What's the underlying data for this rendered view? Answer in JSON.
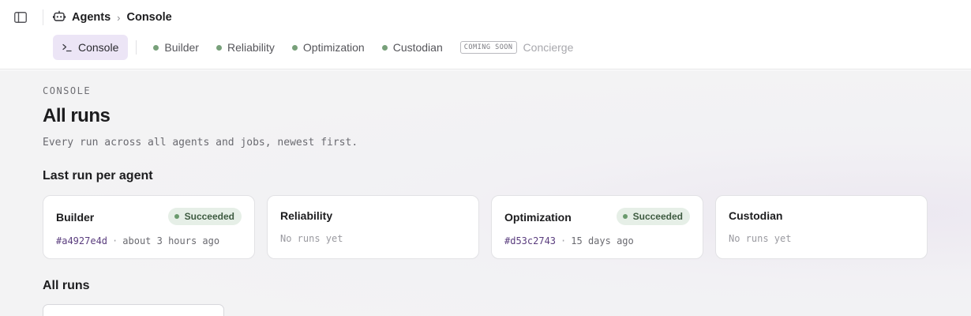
{
  "breadcrumb": {
    "root": "Agents",
    "separator": "›",
    "current": "Console"
  },
  "tabs": [
    {
      "label": "Console",
      "state": "active",
      "icon": "terminal-prompt-icon"
    },
    {
      "label": "Builder",
      "state": "normal"
    },
    {
      "label": "Reliability",
      "state": "normal"
    },
    {
      "label": "Optimization",
      "state": "normal"
    },
    {
      "label": "Custodian",
      "state": "normal"
    },
    {
      "label": "Concierge",
      "state": "disabled",
      "badge": "COMING SOON"
    }
  ],
  "page": {
    "eyebrow": "CONSOLE",
    "title": "All runs",
    "subtitle": "Every run across all agents and jobs, newest first."
  },
  "last_run_section": {
    "title": "Last run per agent"
  },
  "agent_cards": [
    {
      "name": "Builder",
      "status": "Succeeded",
      "run_id": "#a4927e4d",
      "separator": "·",
      "time": "about 3 hours ago"
    },
    {
      "name": "Reliability",
      "empty_text": "No runs yet"
    },
    {
      "name": "Optimization",
      "status": "Succeeded",
      "run_id": "#d53c2743",
      "separator": "·",
      "time": "15 days ago"
    },
    {
      "name": "Custodian",
      "empty_text": "No runs yet"
    }
  ],
  "all_runs_section": {
    "title": "All runs"
  },
  "colors": {
    "accent_tab_bg": "#ece5f6",
    "status_dot": "#78a07a",
    "success_badge_bg": "#e6efe7",
    "run_id": "#5a3d7e"
  }
}
